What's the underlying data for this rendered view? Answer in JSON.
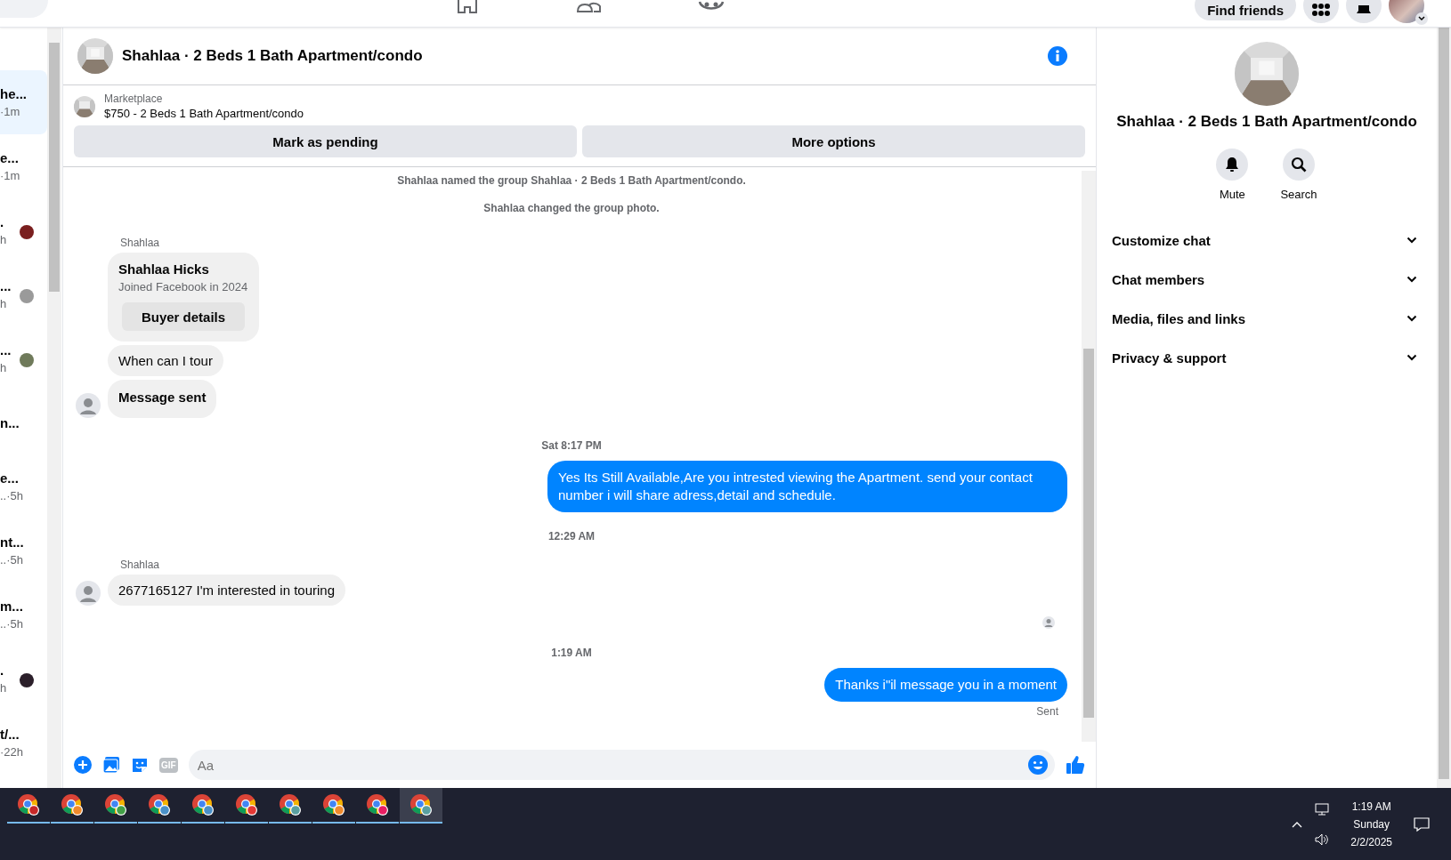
{
  "top_nav": {
    "find_friends": "Find friends"
  },
  "sidebar": {
    "conversations": [
      {
        "title": "he...",
        "meta": "·1m",
        "selected": true,
        "avatar": false
      },
      {
        "title": "e...",
        "meta": "·1m",
        "selected": false,
        "avatar": false
      },
      {
        "title": ".",
        "meta": "h",
        "selected": false,
        "avatar": true
      },
      {
        "title": "...",
        "meta": "h",
        "selected": false,
        "avatar": true
      },
      {
        "title": "...",
        "meta": "h",
        "selected": false,
        "avatar": true
      },
      {
        "title": "n...",
        "selected": false,
        "avatar": false
      },
      {
        "title": "e...",
        "meta": "..·5h",
        "selected": false,
        "avatar": false
      },
      {
        "title": "nt...",
        "meta": "..·5h",
        "selected": false,
        "avatar": false
      },
      {
        "title": "m...",
        "meta": "..·5h",
        "selected": false,
        "avatar": false
      },
      {
        "title": ".",
        "meta": "h",
        "selected": false,
        "avatar": true
      },
      {
        "title": "t/...",
        "meta": "·22h",
        "selected": false,
        "avatar": false
      }
    ]
  },
  "chat": {
    "title": "Shahlaa · 2 Beds 1 Bath Apartment/condo",
    "listing": {
      "label": "Marketplace",
      "text": "$750 - 2 Beds 1 Bath Apartment/condo"
    },
    "actions": [
      "Mark as pending",
      "More options"
    ],
    "messages": [
      {
        "kind": "event",
        "text": "Shahlaa named the group Shahlaa · 2 Beds 1 Bath Apartment/condo."
      },
      {
        "kind": "event",
        "text": "Shahlaa changed the group photo."
      },
      {
        "kind": "sender",
        "text": "Shahlaa"
      },
      {
        "kind": "card",
        "name": "Shahlaa Hicks",
        "subtitle": "Joined Facebook in 2024",
        "button": "Buyer details"
      },
      {
        "kind": "in",
        "text": "When can I tour",
        "bold": false,
        "avatar": false
      },
      {
        "kind": "in",
        "text": "Message sent",
        "bold": true,
        "avatar": true
      },
      {
        "kind": "time",
        "text": "Sat 8:17 PM"
      },
      {
        "kind": "out",
        "text": "Yes Its Still Available,Are you intrested viewing the Apartment. send your contact number i will share adress,detail and schedule."
      },
      {
        "kind": "time",
        "text": "12:29 AM"
      },
      {
        "kind": "sender",
        "text": "Shahlaa"
      },
      {
        "kind": "in",
        "text": "2677165127 I'm interested in touring",
        "bold": false,
        "avatar": true
      },
      {
        "kind": "seen"
      },
      {
        "kind": "time",
        "text": "1:19 AM"
      },
      {
        "kind": "out",
        "text": "Thanks i\"il message you in a moment"
      },
      {
        "kind": "status",
        "text": "Sent"
      }
    ],
    "composer": {
      "placeholder": "Aa",
      "gif_label": "GIF"
    }
  },
  "details": {
    "title": "Shahlaa · 2 Beds 1 Bath Apartment/condo",
    "actions": [
      {
        "kind": "mute",
        "label": "Mute"
      },
      {
        "kind": "search",
        "label": "Search"
      }
    ],
    "sections": [
      "Customize chat",
      "Chat members",
      "Media, files and links",
      "Privacy & support"
    ]
  },
  "taskbar": {
    "apps": [
      {
        "color": "#c62828",
        "selected": false
      },
      {
        "color": "#ef8a2c",
        "selected": false
      },
      {
        "color": "#43a047",
        "selected": false
      },
      {
        "color": "#4a90c8",
        "selected": false
      },
      {
        "color": "#4a90c8",
        "selected": false
      },
      {
        "color": "#e53935",
        "selected": false
      },
      {
        "color": "#5aa0a0",
        "selected": false
      },
      {
        "color": "#ef8a2c",
        "selected": false
      },
      {
        "color": "#e91e63",
        "selected": false
      },
      {
        "color": "#5aa0a0",
        "selected": true
      }
    ],
    "time": "1:19 AM",
    "day": "Sunday",
    "date": "2/2/2025"
  }
}
